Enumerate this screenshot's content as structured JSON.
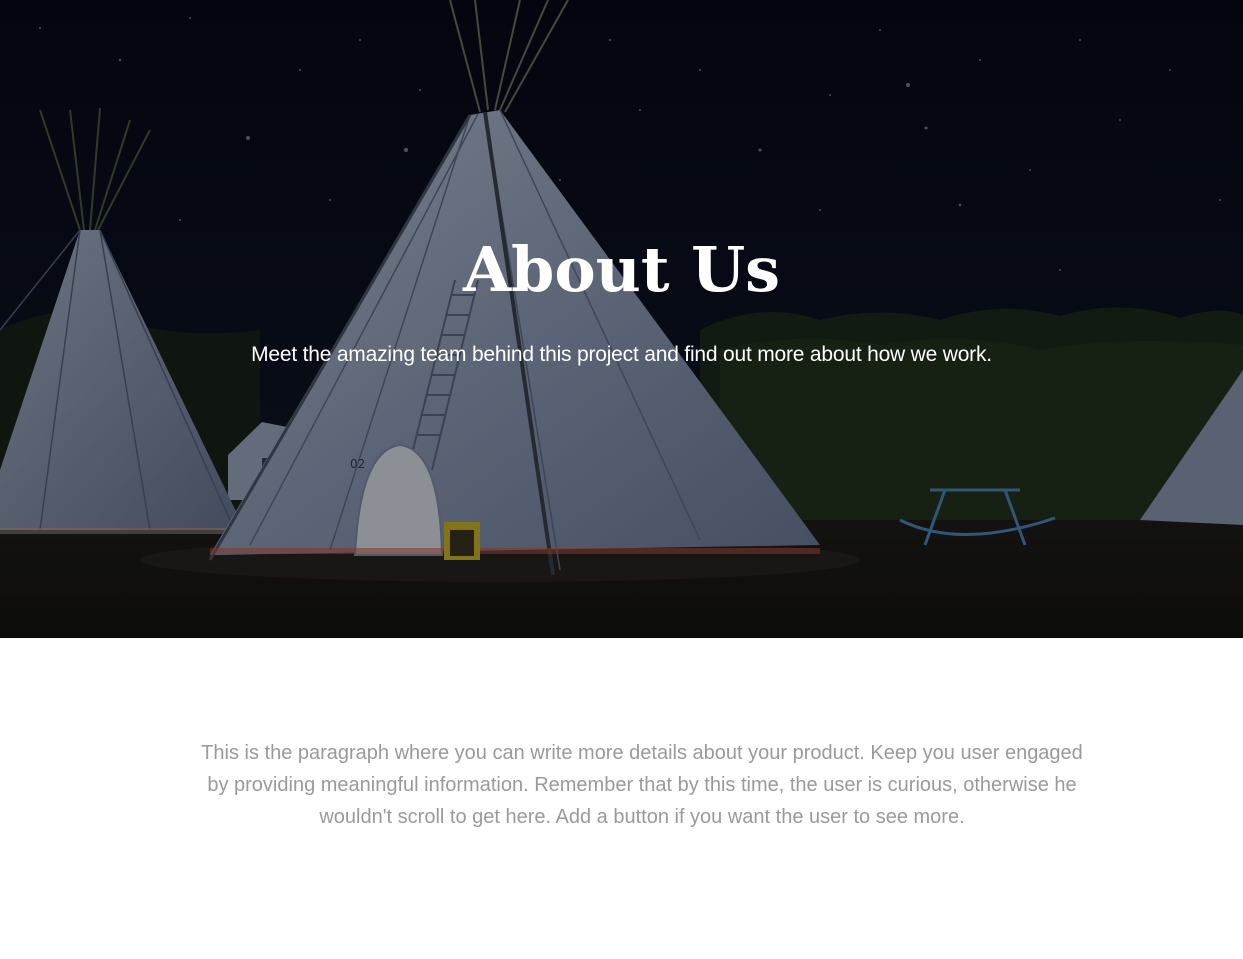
{
  "hero": {
    "title": "About Us",
    "subtitle": "Meet the amazing team behind this project and find out more about how we work.",
    "background": "night-campground-teepees-image",
    "text_color": "#ffffff"
  },
  "details": {
    "paragraph": "This is the paragraph where you can write more details about your product. Keep you user engaged by providing meaningful information. Remember that by this time, the user is curious, otherwise he wouldn't scroll to get here. Add a button if you want the user to see more.",
    "text_color": "#9a9a9a"
  }
}
